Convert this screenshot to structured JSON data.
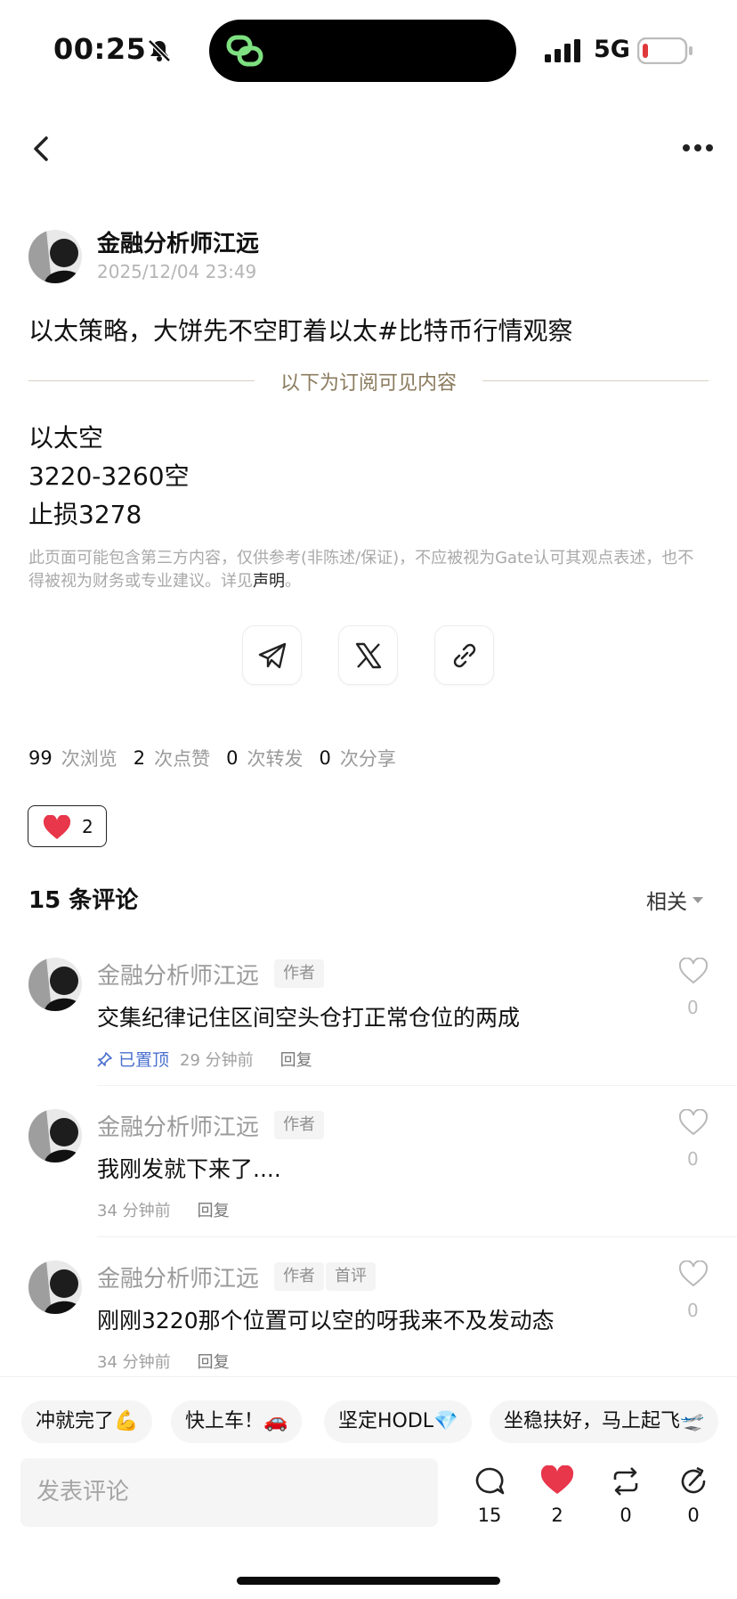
{
  "status_bar": {
    "time": "00:25",
    "network": "5G"
  },
  "post": {
    "author": "金融分析师江远",
    "date": "2025/12/04 23:49",
    "title": "以太策略，大饼先不空盯着以太#比特币行情观察",
    "subscriber_divider": "以下为订阅可见内容",
    "body": [
      "以太空",
      "3220-3260空",
      "止损3278"
    ],
    "disclaimer": "此页面可能包含第三方内容，仅供参考(非陈述/保证)，不应被视为Gate认可其观点表述，也不得被视为财务或专业建议。详见",
    "disclaimer_link": "声明",
    "disclaimer_end": "。"
  },
  "stats": [
    {
      "value": "99",
      "label": "次浏览"
    },
    {
      "value": "2",
      "label": "次点赞"
    },
    {
      "value": "0",
      "label": "次转发"
    },
    {
      "value": "0",
      "label": "次分享"
    }
  ],
  "like_chip": {
    "count": "2"
  },
  "comments_header": {
    "title": "15 条评论",
    "sort": "相关"
  },
  "comments": [
    {
      "name": "金融分析师江远",
      "tags": [
        "作者"
      ],
      "text": "交集纪律记住区间空头仓打正常仓位的两成",
      "pinned": "已置顶",
      "time": "29 分钟前",
      "reply": "回复",
      "likes": "0"
    },
    {
      "name": "金融分析师江远",
      "tags": [
        "作者"
      ],
      "text": "我刚发就下来了....",
      "time": "34 分钟前",
      "reply": "回复",
      "likes": "0"
    },
    {
      "name": "金融分析师江远",
      "tags": [
        "作者",
        "首评"
      ],
      "text": "刚刚3220那个位置可以空的呀我来不及发动态",
      "time": "34 分钟前",
      "reply": "回复",
      "likes": "0"
    }
  ],
  "quick_replies": [
    "冲就完了💪",
    "快上车！🚗",
    "坚定HODL💎",
    "坐稳扶好，马上起飞🛫"
  ],
  "composer": {
    "placeholder": "发表评论"
  },
  "actions": [
    {
      "icon": "comment-icon",
      "count": "15"
    },
    {
      "icon": "heart-icon",
      "count": "2"
    },
    {
      "icon": "repost-icon",
      "count": "0"
    },
    {
      "icon": "share-icon",
      "count": "0"
    }
  ],
  "colors": {
    "accent_heart": "#e8364b",
    "divider_text": "#8b7b5e",
    "pinned_blue": "#4a6fcf"
  }
}
